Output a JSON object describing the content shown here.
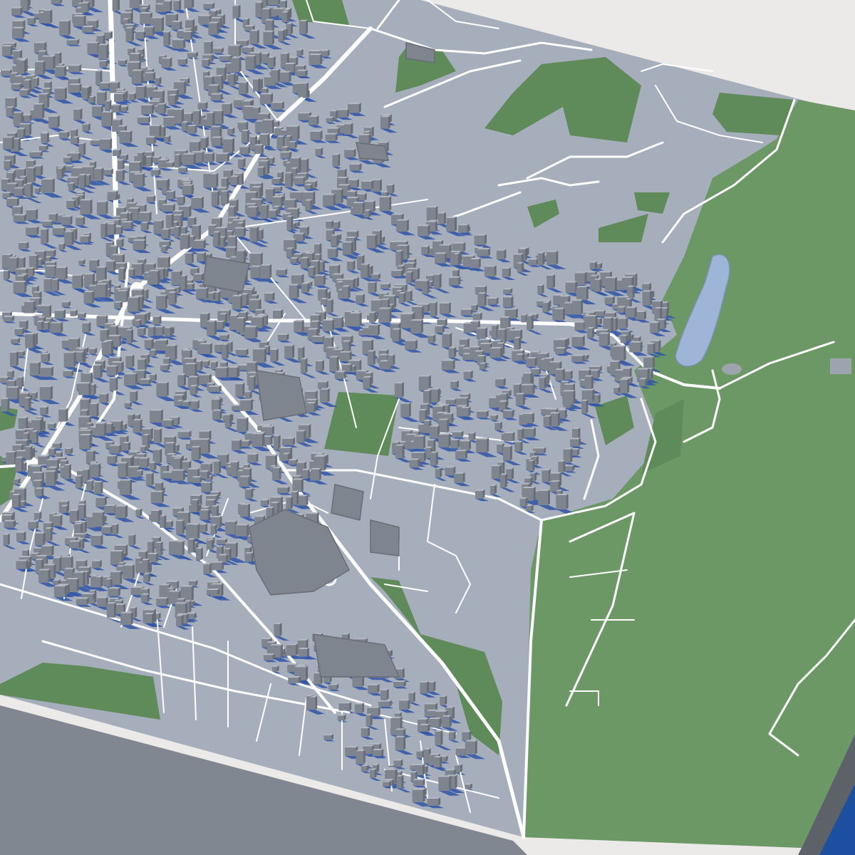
{
  "scene": {
    "colors": {
      "background": "#eceae8",
      "slab_top": "#a6aebc",
      "slab_side": "#5d6168",
      "slab_front": "#808791",
      "park": "#5f8a5a",
      "park_light": "#6b9864",
      "road": "#ffffff",
      "building_top": "#b4b9c2",
      "building_side": "#7f858f",
      "building_dark": "#676c75",
      "shadow": "#2f55a8",
      "water": "#9fb5d8",
      "water_edge": "#1d4fa0"
    },
    "layers": [
      "slab",
      "parks",
      "lake",
      "roads",
      "buildings",
      "shadows"
    ]
  }
}
